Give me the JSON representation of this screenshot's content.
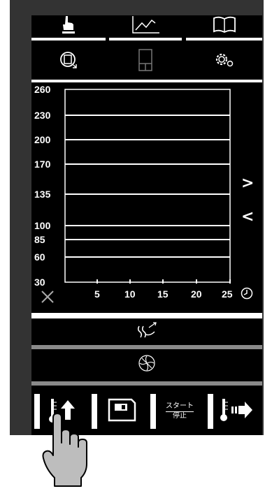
{
  "top_row_icons": [
    "touch-hand-icon",
    "line-chart-icon",
    "open-book-icon"
  ],
  "second_row_icons": [
    "rotate-door-icon",
    "panel-layout-icon",
    "gears-icon"
  ],
  "chart_data": {
    "type": "line",
    "y_tick_labels": [
      "260",
      "230",
      "200",
      "170",
      "135",
      "100",
      "85",
      "60",
      "30"
    ],
    "x_tick_labels": [
      "5",
      "10",
      "15",
      "20",
      "25"
    ],
    "xlim": [
      0,
      25
    ],
    "ylim": [
      30,
      260
    ],
    "grid": true,
    "series": []
  },
  "nav": {
    "next": ">",
    "prev": "<"
  },
  "mode_icons": [
    "steam-icon",
    "fan-icon"
  ],
  "bottom_buttons": {
    "temp_up_icon": "temperature-up-icon",
    "save_icon": "save-disk-icon",
    "start_label": "スタート",
    "stop_label": "停止",
    "temp_transfer_icon": "temperature-transfer-icon"
  },
  "colors": {
    "device": "#333333",
    "screen": "#000000",
    "foreground": "#ffffff",
    "divider": "#8a8a8a"
  }
}
